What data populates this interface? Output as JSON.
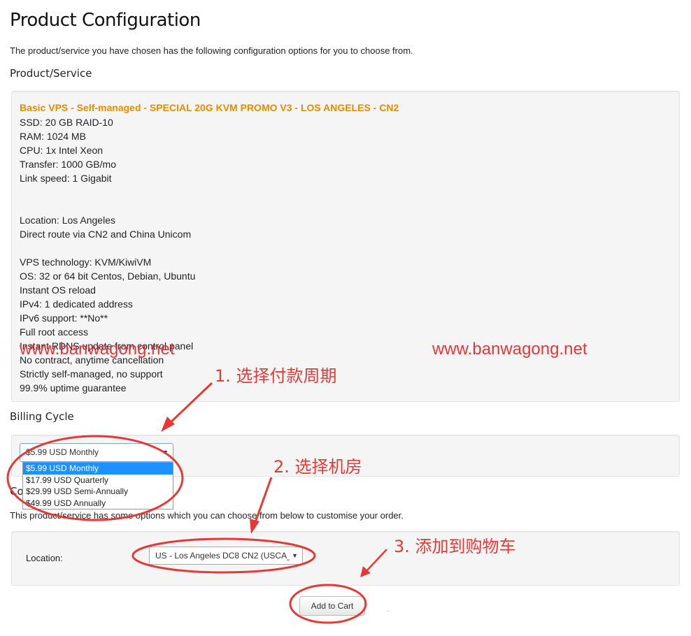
{
  "page": {
    "title": "Product Configuration",
    "intro": "The product/service you have chosen has the following configuration options for you to choose from."
  },
  "product": {
    "heading": "Product/Service",
    "name": "Basic VPS - Self-managed - SPECIAL 20G KVM PROMO V3 - LOS ANGELES - CN2",
    "specs": [
      "SSD: 20 GB RAID-10",
      "RAM: 1024 MB",
      "CPU: 1x Intel Xeon",
      "Transfer: 1000 GB/mo",
      "Link speed: 1 Gigabit",
      "",
      "",
      "Location: Los Angeles",
      "Direct route via CN2 and China Unicom",
      "",
      "VPS technology: KVM/KiwiVM",
      "OS: 32 or 64 bit Centos, Debian, Ubuntu",
      "Instant OS reload",
      "IPv4: 1 dedicated address",
      "IPv6 support: **No**",
      "Full root access",
      "Instant RDNS update from control panel",
      "No contract, anytime cancellation",
      "Strictly self-managed, no support",
      "99.9% uptime guarantee"
    ]
  },
  "billing": {
    "heading": "Billing Cycle",
    "selected": "$5.99 USD Monthly",
    "options": [
      "$5.99 USD Monthly",
      "$17.99 USD Quarterly",
      "$29.99 USD Semi-Annually",
      "$49.99 USD Annually"
    ]
  },
  "config": {
    "heading_visible_part": "Co",
    "intro": "This product/service has some options which you can choose from below to customise your order.",
    "location_label": "Location:",
    "location_selected": "US - Los Angeles DC8 CN2 (USCA_8)"
  },
  "actions": {
    "add_to_cart": "Add to Cart"
  },
  "annotations": {
    "watermark": "www.banwagong.net",
    "step1": "1. 选择付款周期",
    "step2": "2. 选择机房",
    "step3": "3. 添加到购物车",
    "color": "#e53935"
  },
  "colors": {
    "product_name": "#e28c00",
    "dropdown_selected": "#1e90ff",
    "panel_bg": "#f5f5f5"
  }
}
